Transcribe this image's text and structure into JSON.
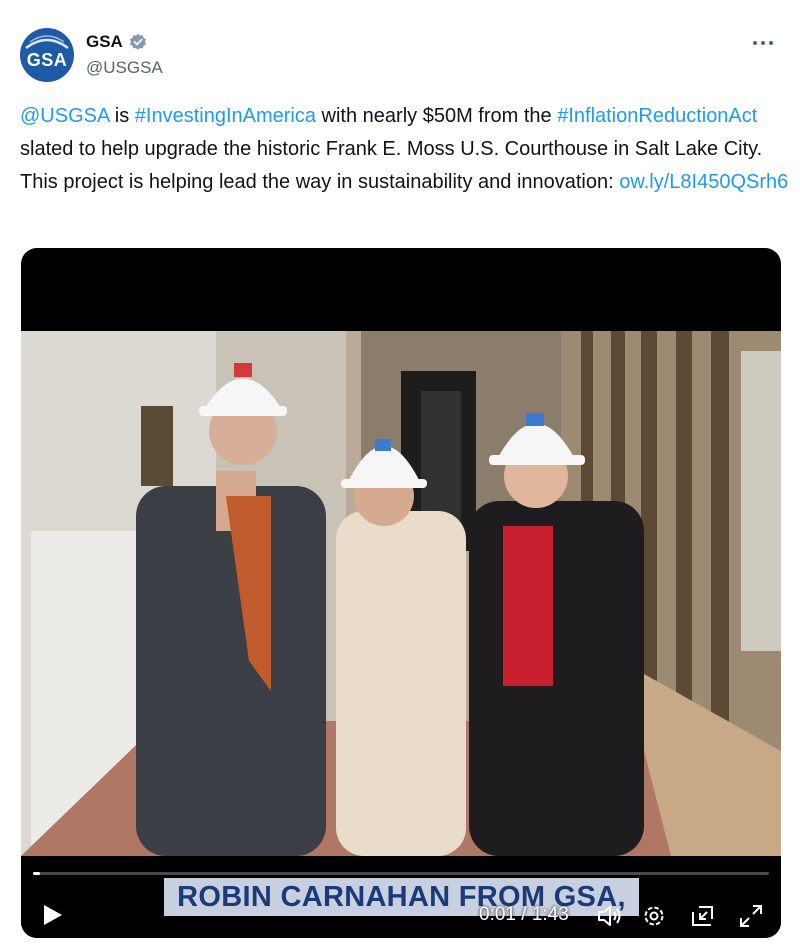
{
  "author": {
    "display_name": "GSA",
    "handle": "@USGSA",
    "avatar_text": "GSA",
    "verified": true
  },
  "tweet": {
    "segments": [
      {
        "text": "@USGSA",
        "type": "mention"
      },
      {
        "text": " is ",
        "type": "plain"
      },
      {
        "text": "#InvestingInAmerica",
        "type": "hashtag"
      },
      {
        "text": " with nearly $50M from the ",
        "type": "plain"
      },
      {
        "text": "#InflationReductionAct",
        "type": "hashtag"
      },
      {
        "text": " slated to help upgrade the historic Frank E. Moss U.S. Courthouse in Salt Lake City. This project is helping lead the way in sustainability and innovation: ",
        "type": "plain"
      },
      {
        "text": "ow.ly/L8I450QSrh6",
        "type": "link"
      }
    ]
  },
  "video": {
    "caption": "ROBIN CARNAHAN FROM GSA,",
    "current_time": "0:01",
    "duration": "1:43",
    "time_display": "0:01 / 1:43",
    "progress": 0.01
  },
  "icons": {
    "more": "more-icon",
    "verified": "verified-badge-icon",
    "play": "play-icon",
    "volume": "volume-icon",
    "settings": "settings-gear-icon",
    "dock": "dock-icon",
    "fullscreen": "fullscreen-icon"
  },
  "colors": {
    "link": "#1d9bf0",
    "avatar_bg": "#1f5aa6",
    "caption_bg": "#c7cfe0",
    "caption_text": "#1a3b78"
  }
}
